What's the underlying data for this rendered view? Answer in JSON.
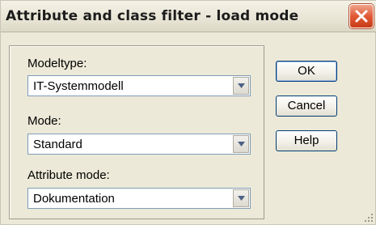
{
  "window": {
    "title": "Attribute and class filter - load mode"
  },
  "fields": [
    {
      "label": "Modeltype:",
      "value": "IT-Systemmodell"
    },
    {
      "label": "Mode:",
      "value": "Standard"
    },
    {
      "label": "Attribute mode:",
      "value": "Dokumentation"
    }
  ],
  "buttons": {
    "ok": "OK",
    "cancel": "Cancel",
    "help": "Help"
  },
  "icons": {
    "close": "close-icon",
    "dropdown": "chevron-down-icon",
    "resize": "resize-grip-icon"
  },
  "colors": {
    "close_button": "#e25a36",
    "dialog_bg": "#ece9d8",
    "input_border": "#7f9db9"
  }
}
